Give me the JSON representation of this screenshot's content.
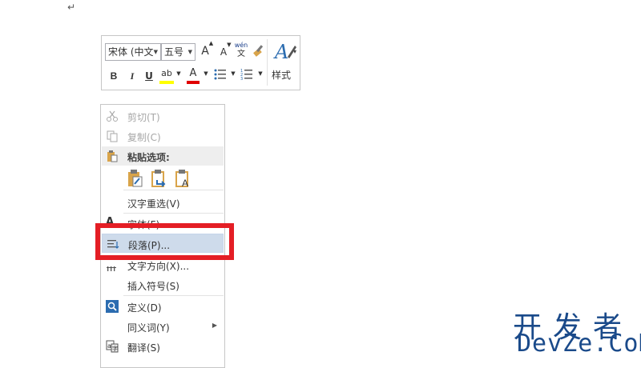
{
  "document": {
    "paragraph_mark": "↵"
  },
  "mini_toolbar": {
    "font_name": "宋体 (中文",
    "font_size": "五号",
    "grow_font": "A",
    "shrink_font": "A",
    "phonetic_top": "wén",
    "phonetic_bottom": "文",
    "bold": "B",
    "italic": "I",
    "underline": "U",
    "highlight": "ab",
    "font_color": "A",
    "styles_label": "样式",
    "highlight_color": "#ffff00",
    "font_color_value": "#e00000"
  },
  "context_menu": {
    "cut": "剪切(T)",
    "copy": "复制(C)",
    "paste_options": "粘贴选项:",
    "reconvert": "汉字重选(V)",
    "font": "字体(F)...",
    "paragraph": "段落(P)...",
    "text_direction": "文字方向(X)...",
    "insert_symbol": "插入符号(S)",
    "define": "定义(D)",
    "synonyms": "同义词(Y)",
    "translate": "翻译(S)"
  },
  "watermark": {
    "cn": "开发者",
    "en": "DevZe.CoM"
  },
  "colors": {
    "highlight_row": "#cedbeb",
    "annotation_red": "#e41e25"
  }
}
